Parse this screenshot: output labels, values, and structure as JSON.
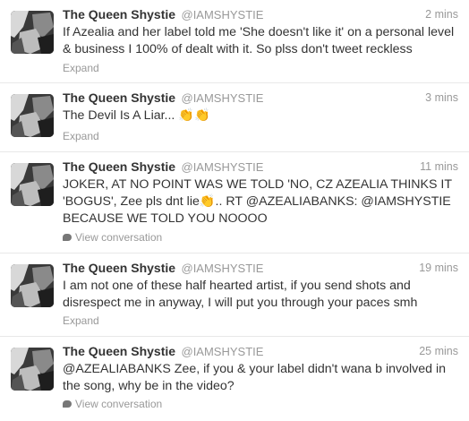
{
  "tweets": [
    {
      "fullname": "The Queen Shystie",
      "username": "@IAMSHYSTIE",
      "time": "2 mins",
      "text": "If Azealia and her label told me 'She doesn't like it' on a personal level & business I 100% of dealt with it. So plss don't tweet reckless",
      "action": "Expand",
      "action_icon": ""
    },
    {
      "fullname": "The Queen Shystie",
      "username": "@IAMSHYSTIE",
      "time": "3 mins",
      "text": "The Devil Is A Liar... 👏👏",
      "action": "Expand",
      "action_icon": ""
    },
    {
      "fullname": "The Queen Shystie",
      "username": "@IAMSHYSTIE",
      "time": "11 mins",
      "text": "JOKER, AT NO POINT WAS WE TOLD 'NO, CZ AZEALIA THINKS IT 'BOGUS', Zee pls dnt lie👏.. RT @AZEALIABANKS: @IAMSHYSTIE BECAUSE WE TOLD YOU NOOOO",
      "action": "View conversation",
      "action_icon": "conversation-icon"
    },
    {
      "fullname": "The Queen Shystie",
      "username": "@IAMSHYSTIE",
      "time": "19 mins",
      "text": "I am not one of these half hearted artist, if you send shots and disrespect me in anyway, I will put you through your paces smh",
      "action": "Expand",
      "action_icon": ""
    },
    {
      "fullname": "The Queen Shystie",
      "username": "@IAMSHYSTIE",
      "time": "25 mins",
      "text": "@AZEALIABANKS Zee, if you & your label didn't wana b involved in the song, why be in the video?",
      "action": "View conversation",
      "action_icon": "conversation-icon"
    }
  ]
}
